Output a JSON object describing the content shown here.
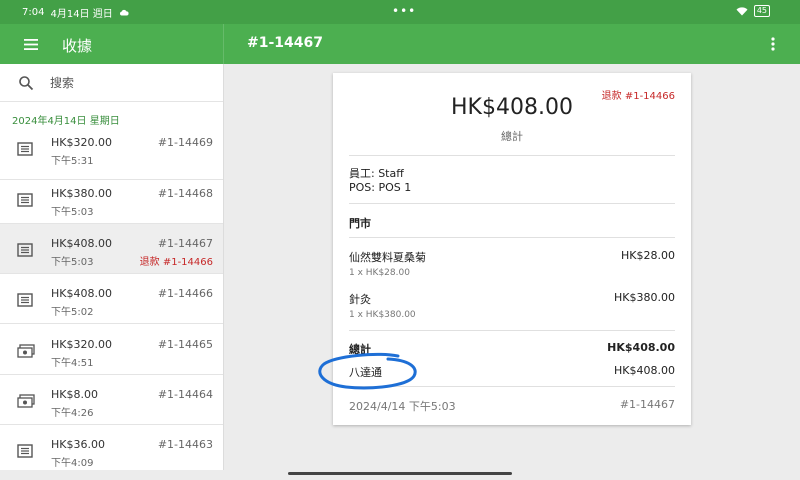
{
  "status_bar": {
    "time": "7:04",
    "date": "4月14日 週日",
    "dots": "•••",
    "battery": "45"
  },
  "app_bar": {
    "title": "收據",
    "receipt_number": "#1-14467"
  },
  "sidebar": {
    "search_placeholder": "搜索",
    "date_header": "2024年4月14日 星期日",
    "items": [
      {
        "icon": "receipt-icon",
        "amount": "HK$320.00",
        "time": "下午5:31",
        "number": "#1-14469",
        "refund": ""
      },
      {
        "icon": "receipt-icon",
        "amount": "HK$380.00",
        "time": "下午5:03",
        "number": "#1-14468",
        "refund": ""
      },
      {
        "icon": "receipt-icon",
        "amount": "HK$408.00",
        "time": "下午5:03",
        "number": "#1-14467",
        "refund": "退款 #1-14466"
      },
      {
        "icon": "receipt-icon",
        "amount": "HK$408.00",
        "time": "下午5:02",
        "number": "#1-14466",
        "refund": ""
      },
      {
        "icon": "cash-icon",
        "amount": "HK$320.00",
        "time": "下午4:51",
        "number": "#1-14465",
        "refund": ""
      },
      {
        "icon": "cash-icon",
        "amount": "HK$8.00",
        "time": "下午4:26",
        "number": "#1-14464",
        "refund": ""
      },
      {
        "icon": "receipt-icon",
        "amount": "HK$36.00",
        "time": "下午4:09",
        "number": "#1-14463",
        "refund": ""
      }
    ]
  },
  "receipt": {
    "refund_label": "退款 #1-14466",
    "total_amount": "HK$408.00",
    "total_label": "總計",
    "employee": "員工: Staff",
    "pos": "POS: POS 1",
    "store": "門市",
    "lines": [
      {
        "name": "仙然雙料夏桑菊",
        "price": "HK$28.00",
        "qty": "1 x HK$28.00"
      },
      {
        "name": "針灸",
        "price": "HK$380.00",
        "qty": "1 x HK$380.00"
      }
    ],
    "sum_label": "總計",
    "sum_value": "HK$408.00",
    "payment_method": "八達通",
    "payment_value": "HK$408.00",
    "datetime": "2024/4/14 下午5:03",
    "footer_number": "#1-14467"
  },
  "colors": {
    "status_bar": "#43a047",
    "app_bar": "#4caf50",
    "refund": "#c62828",
    "annotation": "#1e6fd6"
  }
}
